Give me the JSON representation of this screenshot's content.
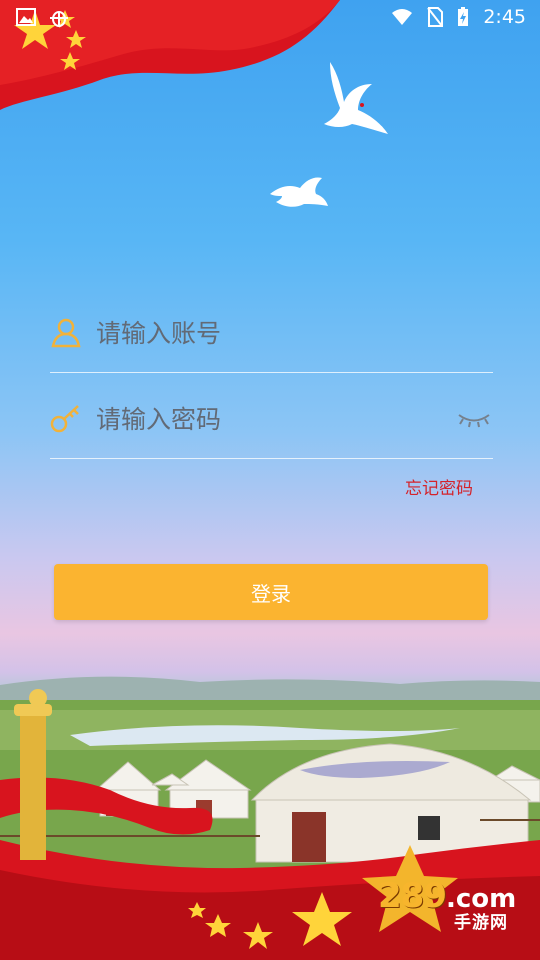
{
  "status_bar": {
    "time": "2:45"
  },
  "login": {
    "username_placeholder": "请输入账号",
    "password_placeholder": "请输入密码",
    "forgot_password": "忘记密码",
    "submit_label": "登录"
  },
  "icons": {
    "username": "user-icon",
    "password": "key-icon",
    "toggle_password": "eye-closed-icon"
  },
  "watermark": {
    "logo": "289",
    "domain": ".com",
    "subtitle": "手游网"
  },
  "colors": {
    "accent_button": "#fbb430",
    "forgot_link": "#d4232b",
    "field_icon": "#f1b23a",
    "flag_red": "#d8141e",
    "star_gold": "#ffd43a"
  }
}
